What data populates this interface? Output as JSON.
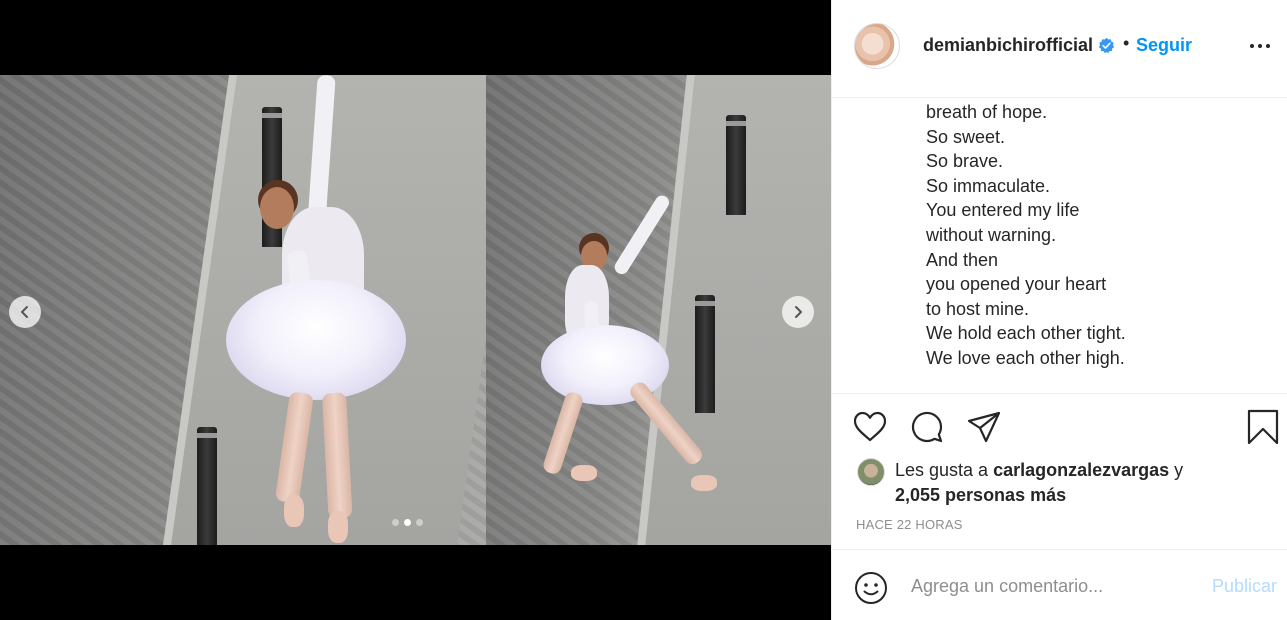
{
  "post": {
    "username": "demianbichirofficial",
    "follow_label": "Seguir",
    "separator": "•",
    "caption_lines": [
      "breath of hope.",
      "So sweet.",
      "So brave.",
      "So immaculate.",
      "You entered my life",
      "without warning.",
      "And then",
      "you opened your heart",
      "to host mine.",
      "We hold each other tight.",
      "We love each other high."
    ],
    "likes": {
      "prefix": "Les gusta a ",
      "user": "carlagonzalezvargas",
      "joiner": " y",
      "others": "2,055 personas más"
    },
    "timestamp": "HACE 22 HORAS"
  },
  "comment": {
    "placeholder": "Agrega un comentario...",
    "publish_label": "Publicar"
  },
  "carousel": {
    "slide_count": 3,
    "active_index": 1
  },
  "colors": {
    "link_blue": "#0095f6",
    "publish_disabled": "#b3dbff",
    "verified": "#3897f0"
  },
  "icons": [
    "chevron-left-icon",
    "chevron-right-icon",
    "verified-badge-icon",
    "more-options-icon",
    "heart-icon",
    "comment-icon",
    "share-icon",
    "bookmark-icon",
    "emoji-icon"
  ]
}
